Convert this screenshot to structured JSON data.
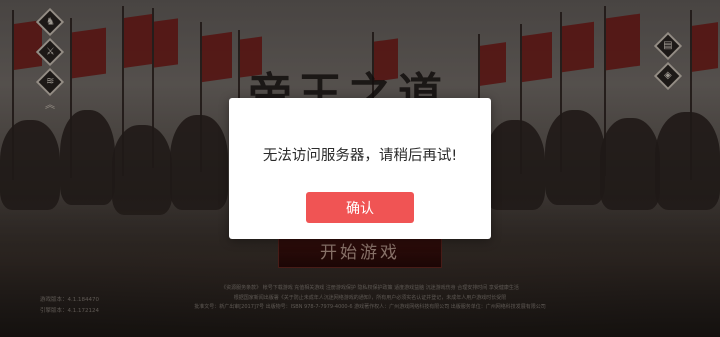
{
  "background": {
    "title_art": "帝王之道"
  },
  "side_left_icons": [
    "helmet-icon",
    "crossed-weapons-icon",
    "scroll-icon",
    "double-chevron-icon"
  ],
  "side_right_icons": [
    "book-icon",
    "cube-icon"
  ],
  "start_button": {
    "label": "开始游戏"
  },
  "version_info": {
    "line1": "游戏版本：4.1.184470",
    "line2": "引擎版本：4.1.172124"
  },
  "footer": {
    "lines": [
      "《资源服务条款》 帐号下载游戏 充值相关游戏 注册游戏保护 隐私权保护政策 适度游戏益脑 沉迷游戏伤身 合理安排时间 享受健康生活",
      "根据国家新闻出版署《关于防止未成年人沉迷网络游戏的通知》，所有用户必须实名认证并登记，未成年人用户游戏时长受限",
      "批准文号：新广出审[2017]7号 出版物号：ISBN 978-7-7979-4000-6 游戏著作权人：广州游戏网络科技有限公司 出版服务单位：广州网络科技发展有限公司"
    ]
  },
  "dialog": {
    "message": "无法访问服务器，请稍后再试!",
    "confirm_label": "确认"
  },
  "colors": {
    "confirm_button": "#f05454",
    "start_button": "#3a0f0c",
    "dialog_bg": "#ffffff"
  }
}
